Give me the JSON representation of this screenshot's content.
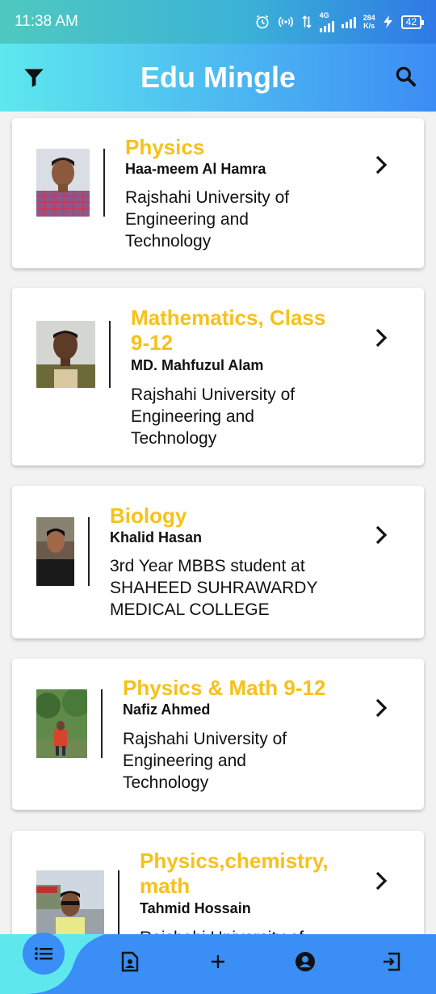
{
  "status_bar": {
    "time": "11:38 AM",
    "network": "4G",
    "speed_value": "284",
    "speed_unit": "K/s",
    "battery": "42"
  },
  "app_bar": {
    "title": "Edu Mingle",
    "left_icon": "filter-icon",
    "right_icon": "search-icon"
  },
  "tutors": [
    {
      "subject": "Physics",
      "name": "Haa-meem Al Hamra",
      "institution": "Rajshahi University of Engineering and Technology"
    },
    {
      "subject": "Mathematics, Class 9-12",
      "name": "MD. Mahfuzul Alam",
      "institution": "Rajshahi University of Engineering and Technology"
    },
    {
      "subject": "Biology",
      "name": "Khalid Hasan",
      "institution": "3rd Year MBBS student at SHAHEED SUHRAWARDY MEDICAL COLLEGE"
    },
    {
      "subject": "Physics & Math 9-12",
      "name": "Nafiz Ahmed",
      "institution": "Rajshahi University of Engineering and Technology"
    },
    {
      "subject": "Physics,chemistry, math",
      "name": "Tahmid Hossain",
      "institution": "Rajshahi University of Engineering and Technology"
    }
  ],
  "bottom_nav": {
    "items": [
      "list-icon",
      "profile-document-icon",
      "add-icon",
      "account-icon",
      "logout-icon"
    ],
    "active": "list-icon"
  },
  "colors": {
    "accent": "#3a8ef5",
    "subject": "#f7c118",
    "teal": "#5ee8ee"
  }
}
